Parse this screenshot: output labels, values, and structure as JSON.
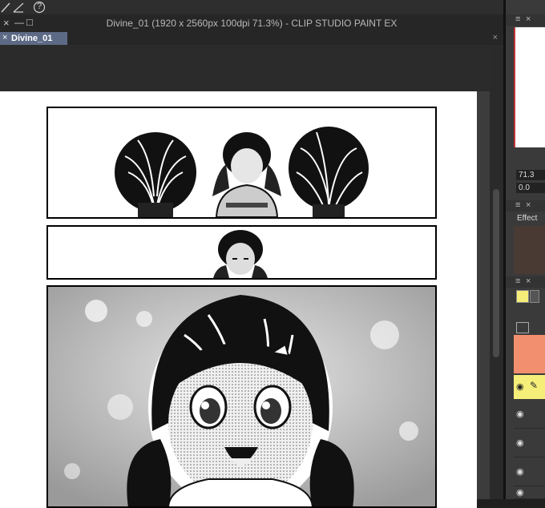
{
  "window": {
    "title": "Divine_01 (1920 x 2560px 100dpi 71.3%)  - CLIP STUDIO PAINT EX",
    "tab_label": "Divine_01",
    "tab_close": "×",
    "controls": {
      "close": "×",
      "minimize": "—",
      "maximize": "□"
    }
  },
  "toolbar": {
    "icons": [
      "brush-icon",
      "ruler-icon",
      "help-icon"
    ],
    "help_glyph": "?"
  },
  "right_panels": {
    "navigator_zoom": "71.3",
    "navigator_angle": "0.0",
    "effect_label": "Effect",
    "panel_close": "×",
    "panel_menu": "≡",
    "layer_colors": {
      "selected": "#f5ef7a",
      "folder": "#f28f6e"
    }
  }
}
